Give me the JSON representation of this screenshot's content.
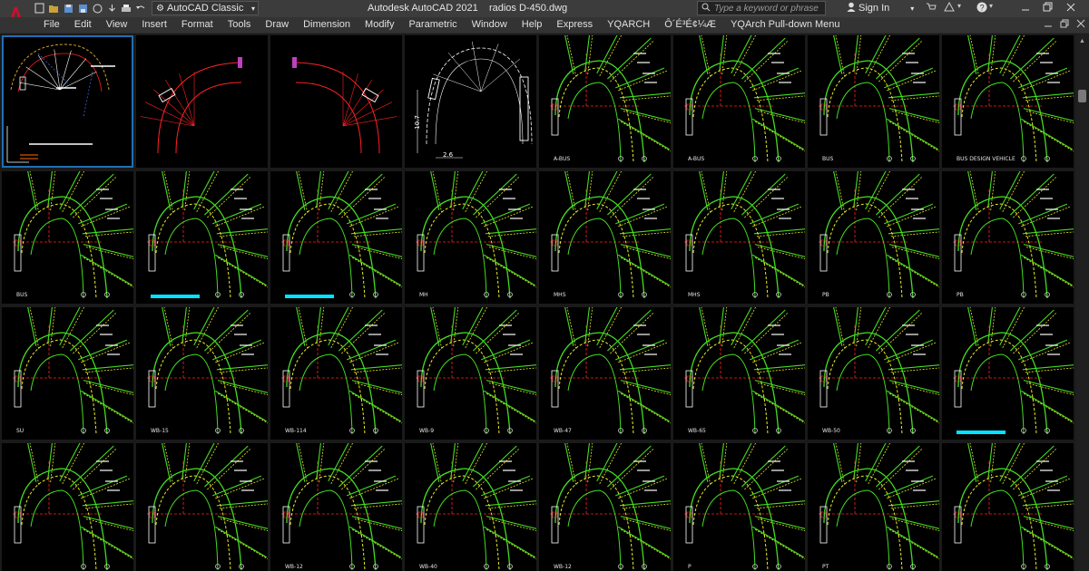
{
  "app": {
    "logo_letter": "A",
    "window_title": "Autodesk AutoCAD 2021",
    "document_name": "radios D-450.dwg",
    "accent": "#c8102e"
  },
  "workspace": {
    "label": "AutoCAD Classic"
  },
  "search": {
    "placeholder": "Type a keyword or phrase"
  },
  "account": {
    "signin_label": "Sign In"
  },
  "menus": [
    "File",
    "Edit",
    "View",
    "Insert",
    "Format",
    "Tools",
    "Draw",
    "Dimension",
    "Modify",
    "Parametric",
    "Window",
    "Help",
    "Express",
    "YQARCH",
    "Ô´É³É¢¼Æ",
    "YQArch Pull-down Menu"
  ],
  "viewports": [
    {
      "label": "",
      "type": "overview"
    },
    {
      "label": "",
      "type": "swept-red-a"
    },
    {
      "label": "",
      "type": "swept-red-b"
    },
    {
      "label": "",
      "type": "arch-dims",
      "dims": [
        "10.7",
        "2.6"
      ]
    },
    {
      "label": "A-BUS"
    },
    {
      "label": "A-BUS"
    },
    {
      "label": "BUS"
    },
    {
      "label": "BUS DESIGN VEHICLE"
    },
    {
      "label": "BUS"
    },
    {
      "label": "",
      "bar": true
    },
    {
      "label": "",
      "bar": true
    },
    {
      "label": "MH"
    },
    {
      "label": "MHS"
    },
    {
      "label": "MHS"
    },
    {
      "label": "PB"
    },
    {
      "label": "PB"
    },
    {
      "label": "SU"
    },
    {
      "label": "WB-15"
    },
    {
      "label": "WB-114"
    },
    {
      "label": "WB-9"
    },
    {
      "label": "WB-47"
    },
    {
      "label": "WB-65"
    },
    {
      "label": "WB-50"
    },
    {
      "label": "",
      "bar": true
    },
    {
      "label": ""
    },
    {
      "label": ""
    },
    {
      "label": "WB-12"
    },
    {
      "label": "WB-40"
    },
    {
      "label": "WB-12"
    },
    {
      "label": "P"
    },
    {
      "label": "PT"
    },
    {
      "label": ""
    }
  ],
  "colors": {
    "curve_green": "#44dd22",
    "curve_yellow": "#e8ee22",
    "dim_red": "#ff2222",
    "label_white": "#e6e6e6",
    "cyan_bar": "#00e5ff"
  }
}
